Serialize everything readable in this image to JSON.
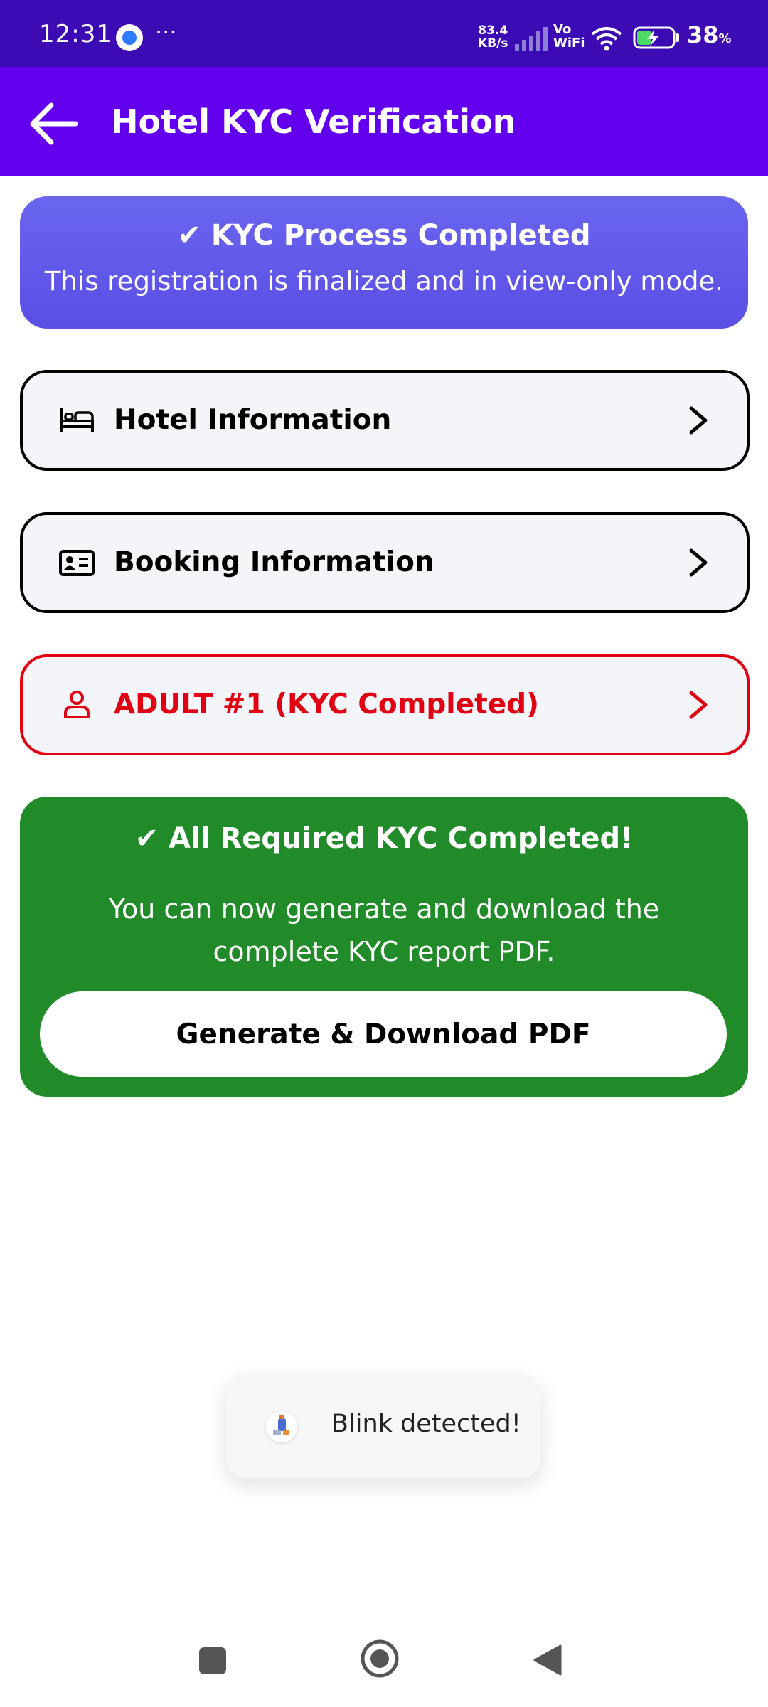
{
  "status_bar": {
    "time": "12:31",
    "more": "···",
    "net_speed_value": "83.4",
    "net_speed_unit": "KB/s",
    "vo": "Vo",
    "wifi_label": "WiFi",
    "battery_percent": "38",
    "percent_sign": "%"
  },
  "app_bar": {
    "title": "Hotel KYC Verification",
    "back_icon": "arrow-back-icon"
  },
  "banner": {
    "title": "✔ KYC Process Completed",
    "subtitle": "This registration is finalized and in view-only mode.",
    "color": "#5b52e8"
  },
  "sections": [
    {
      "label": "Hotel Information",
      "icon": "bed-icon",
      "state": "normal"
    },
    {
      "label": "Booking Information",
      "icon": "id-card-icon",
      "state": "normal"
    },
    {
      "label": "ADULT #1 (KYC Completed)",
      "icon": "person-icon",
      "state": "highlight",
      "color": "#e00012"
    }
  ],
  "completion": {
    "title": "✔ All Required KYC Completed!",
    "message": "You can now generate and download the complete KYC report PDF.",
    "button_label": "Generate & Download PDF",
    "color": "#218b2a"
  },
  "toast": {
    "text": "Blink detected!",
    "icon": "app-icon"
  },
  "nav_bar": {
    "recents": "square-icon",
    "home": "home-circle-icon",
    "back": "back-triangle-icon"
  }
}
